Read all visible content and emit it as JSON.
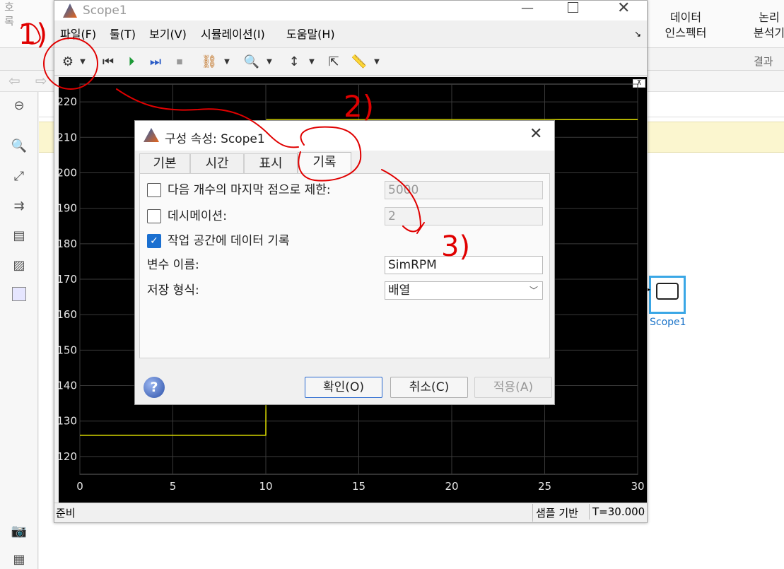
{
  "background": {
    "left_tab": [
      "호",
      "록"
    ],
    "ribbon_data_inspector": [
      "데이터",
      "인스펙터"
    ],
    "ribbon_logic_analyzer": [
      "논리",
      "분석기"
    ],
    "ribbon_section": "결과",
    "block_label": "Scope1"
  },
  "scope": {
    "title": "Scope1",
    "menu": [
      "파일(F)",
      "툴(T)",
      "보기(V)",
      "시뮬레이션(I)",
      "도움말(H)"
    ],
    "status": "준비",
    "status_mode": "샘플 기반",
    "status_time": "T=30.000"
  },
  "chart_data": {
    "type": "line",
    "x": [
      0,
      10,
      10.05,
      30
    ],
    "y": [
      126,
      126,
      215,
      215
    ],
    "xlim": [
      0,
      30
    ],
    "ylim": [
      115,
      225
    ],
    "xticks": [
      "0",
      "5",
      "10",
      "15",
      "20",
      "25",
      "30"
    ],
    "yticks": [
      "120",
      "130",
      "140",
      "150",
      "160",
      "170",
      "180",
      "190",
      "200",
      "210",
      "220"
    ],
    "line_color": "#e6e600",
    "background": "#000000",
    "grid": true
  },
  "dialog": {
    "title": "구성 속성: Scope1",
    "tabs": [
      "기본",
      "시간",
      "표시",
      "기록"
    ],
    "active_tab": "기록",
    "limit_label": "다음 개수의 마지막 점으로 제한:",
    "limit_value": "5000",
    "limit_checked": false,
    "decimation_label": "데시메이션:",
    "decimation_value": "2",
    "decimation_checked": false,
    "log_label": "작업 공간에 데이터 기록",
    "log_checked": true,
    "varname_label": "변수 이름:",
    "varname_value": "SimRPM",
    "format_label": "저장 형식:",
    "format_value": "배열",
    "ok": "확인(O)",
    "cancel": "취소(C)",
    "apply": "적용(A)"
  },
  "annotations": [
    "1)",
    "2)",
    "3)"
  ]
}
